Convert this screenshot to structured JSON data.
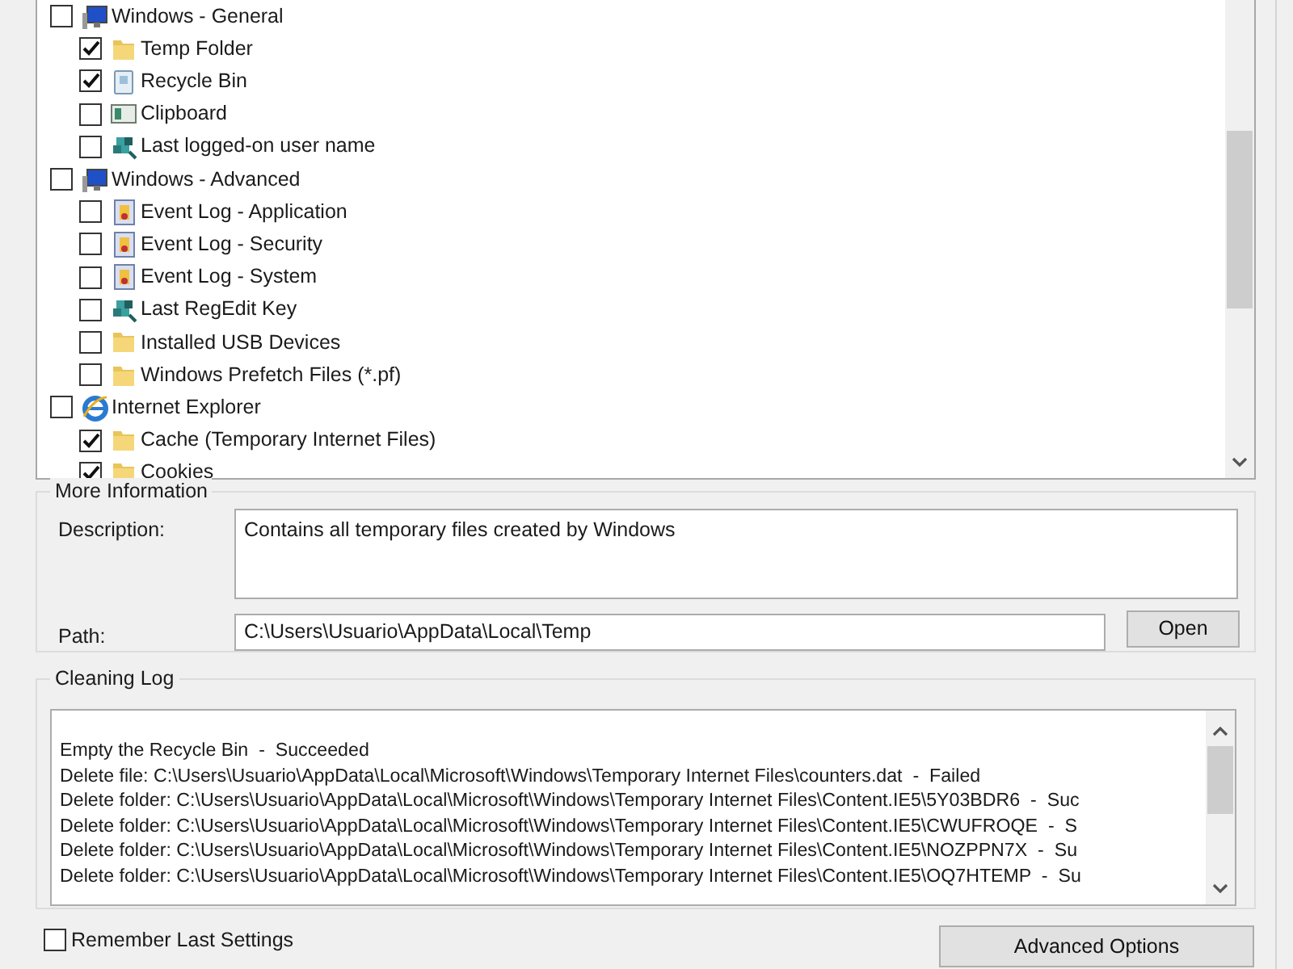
{
  "tree": [
    {
      "label": "Windows - General",
      "checked": false,
      "kind": "monitor",
      "children": [
        {
          "label": "Temp Folder",
          "checked": true,
          "kind": "folder"
        },
        {
          "label": "Recycle Bin",
          "checked": true,
          "kind": "bin"
        },
        {
          "label": "Clipboard",
          "checked": false,
          "kind": "clipboard"
        },
        {
          "label": "Last logged-on user name",
          "checked": false,
          "kind": "registry"
        }
      ]
    },
    {
      "label": "Windows - Advanced",
      "checked": false,
      "kind": "monitor",
      "children": [
        {
          "label": "Event Log - Application",
          "checked": false,
          "kind": "log"
        },
        {
          "label": "Event Log - Security",
          "checked": false,
          "kind": "log"
        },
        {
          "label": "Event Log - System",
          "checked": false,
          "kind": "log"
        },
        {
          "label": "Last RegEdit Key",
          "checked": false,
          "kind": "registry"
        },
        {
          "label": "Installed USB Devices",
          "checked": false,
          "kind": "folder"
        },
        {
          "label": "Windows Prefetch Files (*.pf)",
          "checked": false,
          "kind": "folder"
        }
      ]
    },
    {
      "label": "Internet Explorer",
      "checked": false,
      "kind": "browser",
      "children": [
        {
          "label": "Cache (Temporary Internet Files)",
          "checked": true,
          "kind": "folder"
        },
        {
          "label": "Cookies",
          "checked": true,
          "kind": "folder"
        }
      ]
    }
  ],
  "more_information": {
    "title": "More Information",
    "description_label": "Description:",
    "description": "Contains all temporary files created by Windows",
    "path_label": "Path:",
    "path": "C:\\Users\\Usuario\\AppData\\Local\\Temp",
    "open_button": "Open"
  },
  "cleaning_log": {
    "title": "Cleaning Log",
    "lines": [
      "Empty the Recycle Bin  -  Succeeded",
      "Delete file: C:\\Users\\Usuario\\AppData\\Local\\Microsoft\\Windows\\Temporary Internet Files\\counters.dat  -  Failed",
      "Delete folder: C:\\Users\\Usuario\\AppData\\Local\\Microsoft\\Windows\\Temporary Internet Files\\Content.IE5\\5Y03BDR6  -  Suc",
      "Delete folder: C:\\Users\\Usuario\\AppData\\Local\\Microsoft\\Windows\\Temporary Internet Files\\Content.IE5\\CWUFROQE  -  S",
      "Delete folder: C:\\Users\\Usuario\\AppData\\Local\\Microsoft\\Windows\\Temporary Internet Files\\Content.IE5\\NOZPPN7X  -  Su",
      "Delete folder: C:\\Users\\Usuario\\AppData\\Local\\Microsoft\\Windows\\Temporary Internet Files\\Content.IE5\\OQ7HTEMP  -  Su"
    ]
  },
  "remember_last_settings": {
    "label": "Remember Last Settings",
    "checked": false
  },
  "advanced_options_button": "Advanced Options"
}
